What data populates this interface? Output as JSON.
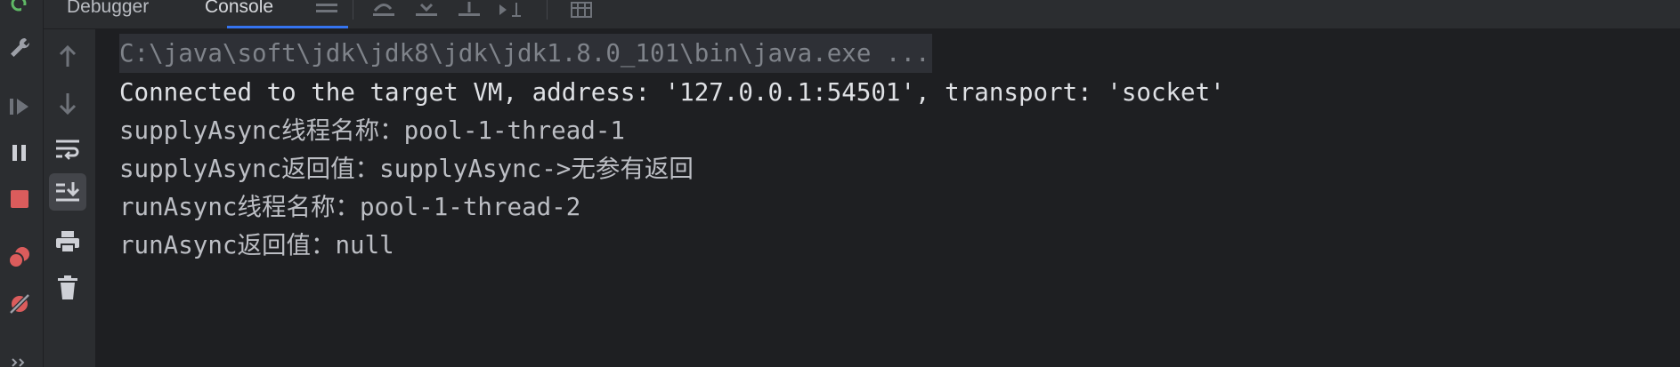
{
  "tabs": [
    {
      "label": "Debugger",
      "active": false
    },
    {
      "label": "Console",
      "active": true
    }
  ],
  "toolbar_icons": [
    "menu-icon",
    "step-over-icon",
    "step-into-icon",
    "step-out-icon",
    "run-to-cursor-icon",
    "table-icon"
  ],
  "left_strip_icons": [
    "resume-small-icon",
    "settings-icon",
    "resume-icon",
    "pause-icon",
    "stop-icon",
    "view-breakpoints-icon",
    "mute-breakpoints-icon",
    "more-icon"
  ],
  "gutter_icons": [
    "up-arrow-icon",
    "down-arrow-icon",
    "soft-wrap-icon",
    "scroll-to-end-icon",
    "print-icon",
    "clear-all-icon"
  ],
  "console": {
    "lines": [
      {
        "text": "C:\\java\\soft\\jdk\\jdk8\\jdk\\jdk1.8.0_101\\bin\\java.exe ...",
        "kind": "cmd"
      },
      {
        "text": "Connected to the target VM, address: '127.0.0.1:54501', transport: 'socket'",
        "kind": "info"
      },
      {
        "text": "supplyAsync线程名称：pool-1-thread-1",
        "kind": "out"
      },
      {
        "text": "supplyAsync返回值：supplyAsync->无参有返回",
        "kind": "out"
      },
      {
        "text": "runAsync线程名称：pool-1-thread-2",
        "kind": "out"
      },
      {
        "text": "runAsync返回值：null",
        "kind": "out"
      }
    ]
  },
  "colors": {
    "background": "#2b2d30",
    "console_bg": "#1e1f22",
    "accent": "#3574f0",
    "stop_red": "#db5c5c",
    "text": "#bcbec4"
  }
}
